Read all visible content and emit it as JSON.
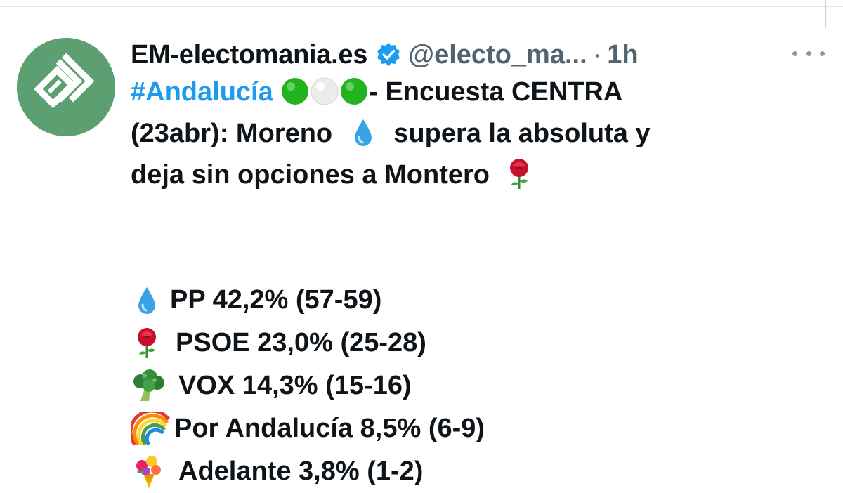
{
  "tweet": {
    "display_name": "EM-electomania.es",
    "handle": "@electo_ma...",
    "separator": "·",
    "time": "1h",
    "text": {
      "hashtag": "#Andalucía",
      "line1_rest": "- Encuesta CENTRA",
      "line2_a": "(23abr): Moreno",
      "line2_b": "supera la absoluta y",
      "line3": "deja sin opciones a Montero"
    },
    "results": [
      {
        "label": "PP 42,2% (57-59)",
        "icon": "droplet-emoji"
      },
      {
        "label": "PSOE 23,0% (25-28)",
        "icon": "rose-emoji"
      },
      {
        "label": "VOX 14,3% (15-16)",
        "icon": "broccoli-emoji"
      },
      {
        "label": "Por Andalucía 8,5% (6-9)",
        "icon": "rainbow-emoji"
      },
      {
        "label": "Adelante 3,8% (1-2)",
        "icon": "bouquet-emoji"
      }
    ]
  },
  "colors": {
    "link": "#1d9bf0",
    "verified": "#1d9bf0",
    "avatar_bg": "#5c9f70",
    "secondary_text": "#536471"
  }
}
